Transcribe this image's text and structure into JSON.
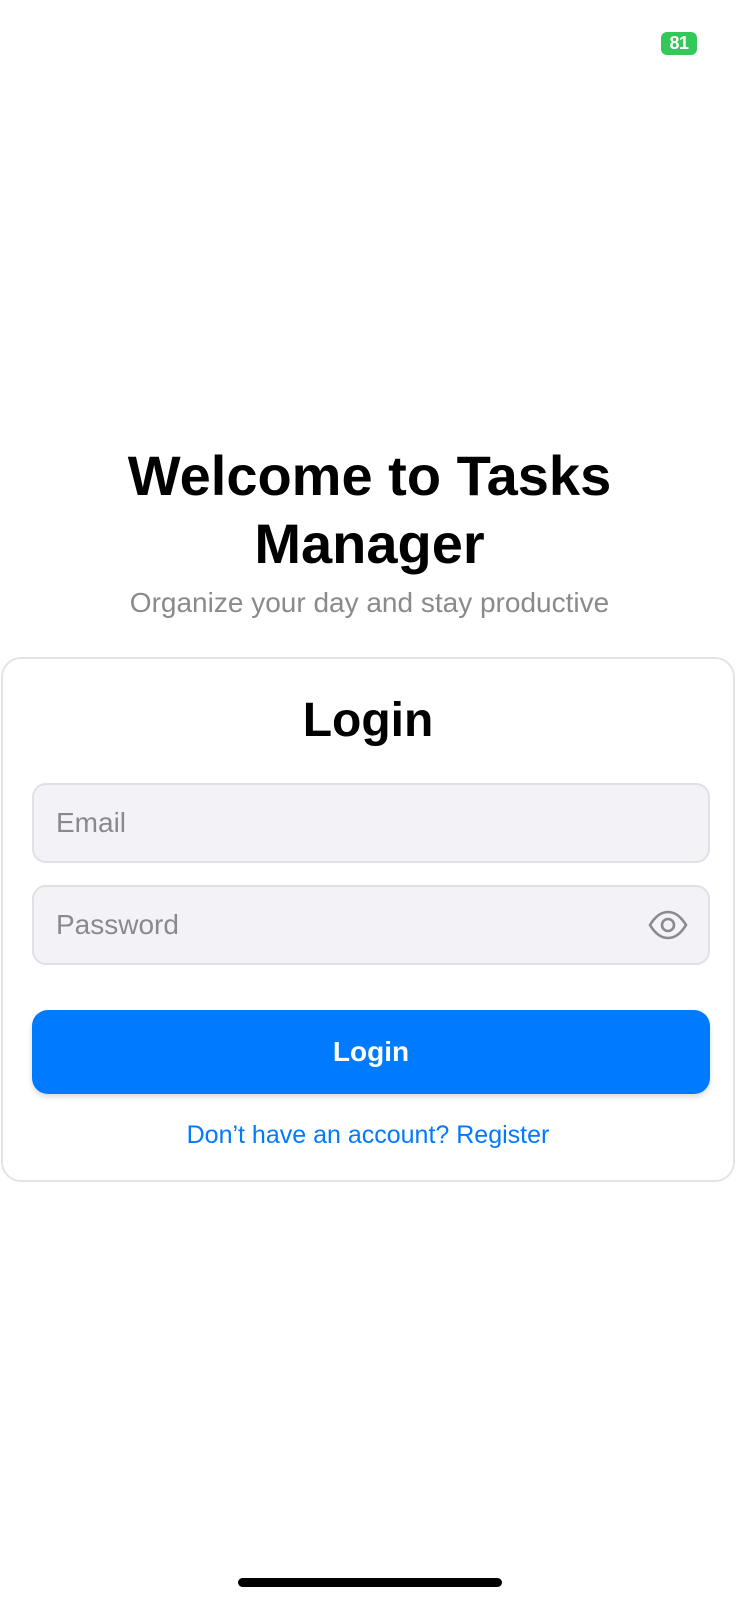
{
  "status_bar": {
    "battery_level": "81"
  },
  "hero": {
    "title": "Welcome to Tasks Manager",
    "subtitle": "Organize your day and stay productive"
  },
  "login_card": {
    "title": "Login",
    "email": {
      "placeholder": "Email",
      "value": ""
    },
    "password": {
      "placeholder": "Password",
      "value": "",
      "toggle_icon": "eye-icon"
    },
    "submit_label": "Login",
    "register_link": "Don’t have an account? Register"
  },
  "colors": {
    "accent": "#007aff",
    "battery": "#34c759",
    "subtitle": "#8a8a8e",
    "field_background": "#f2f2f7"
  }
}
